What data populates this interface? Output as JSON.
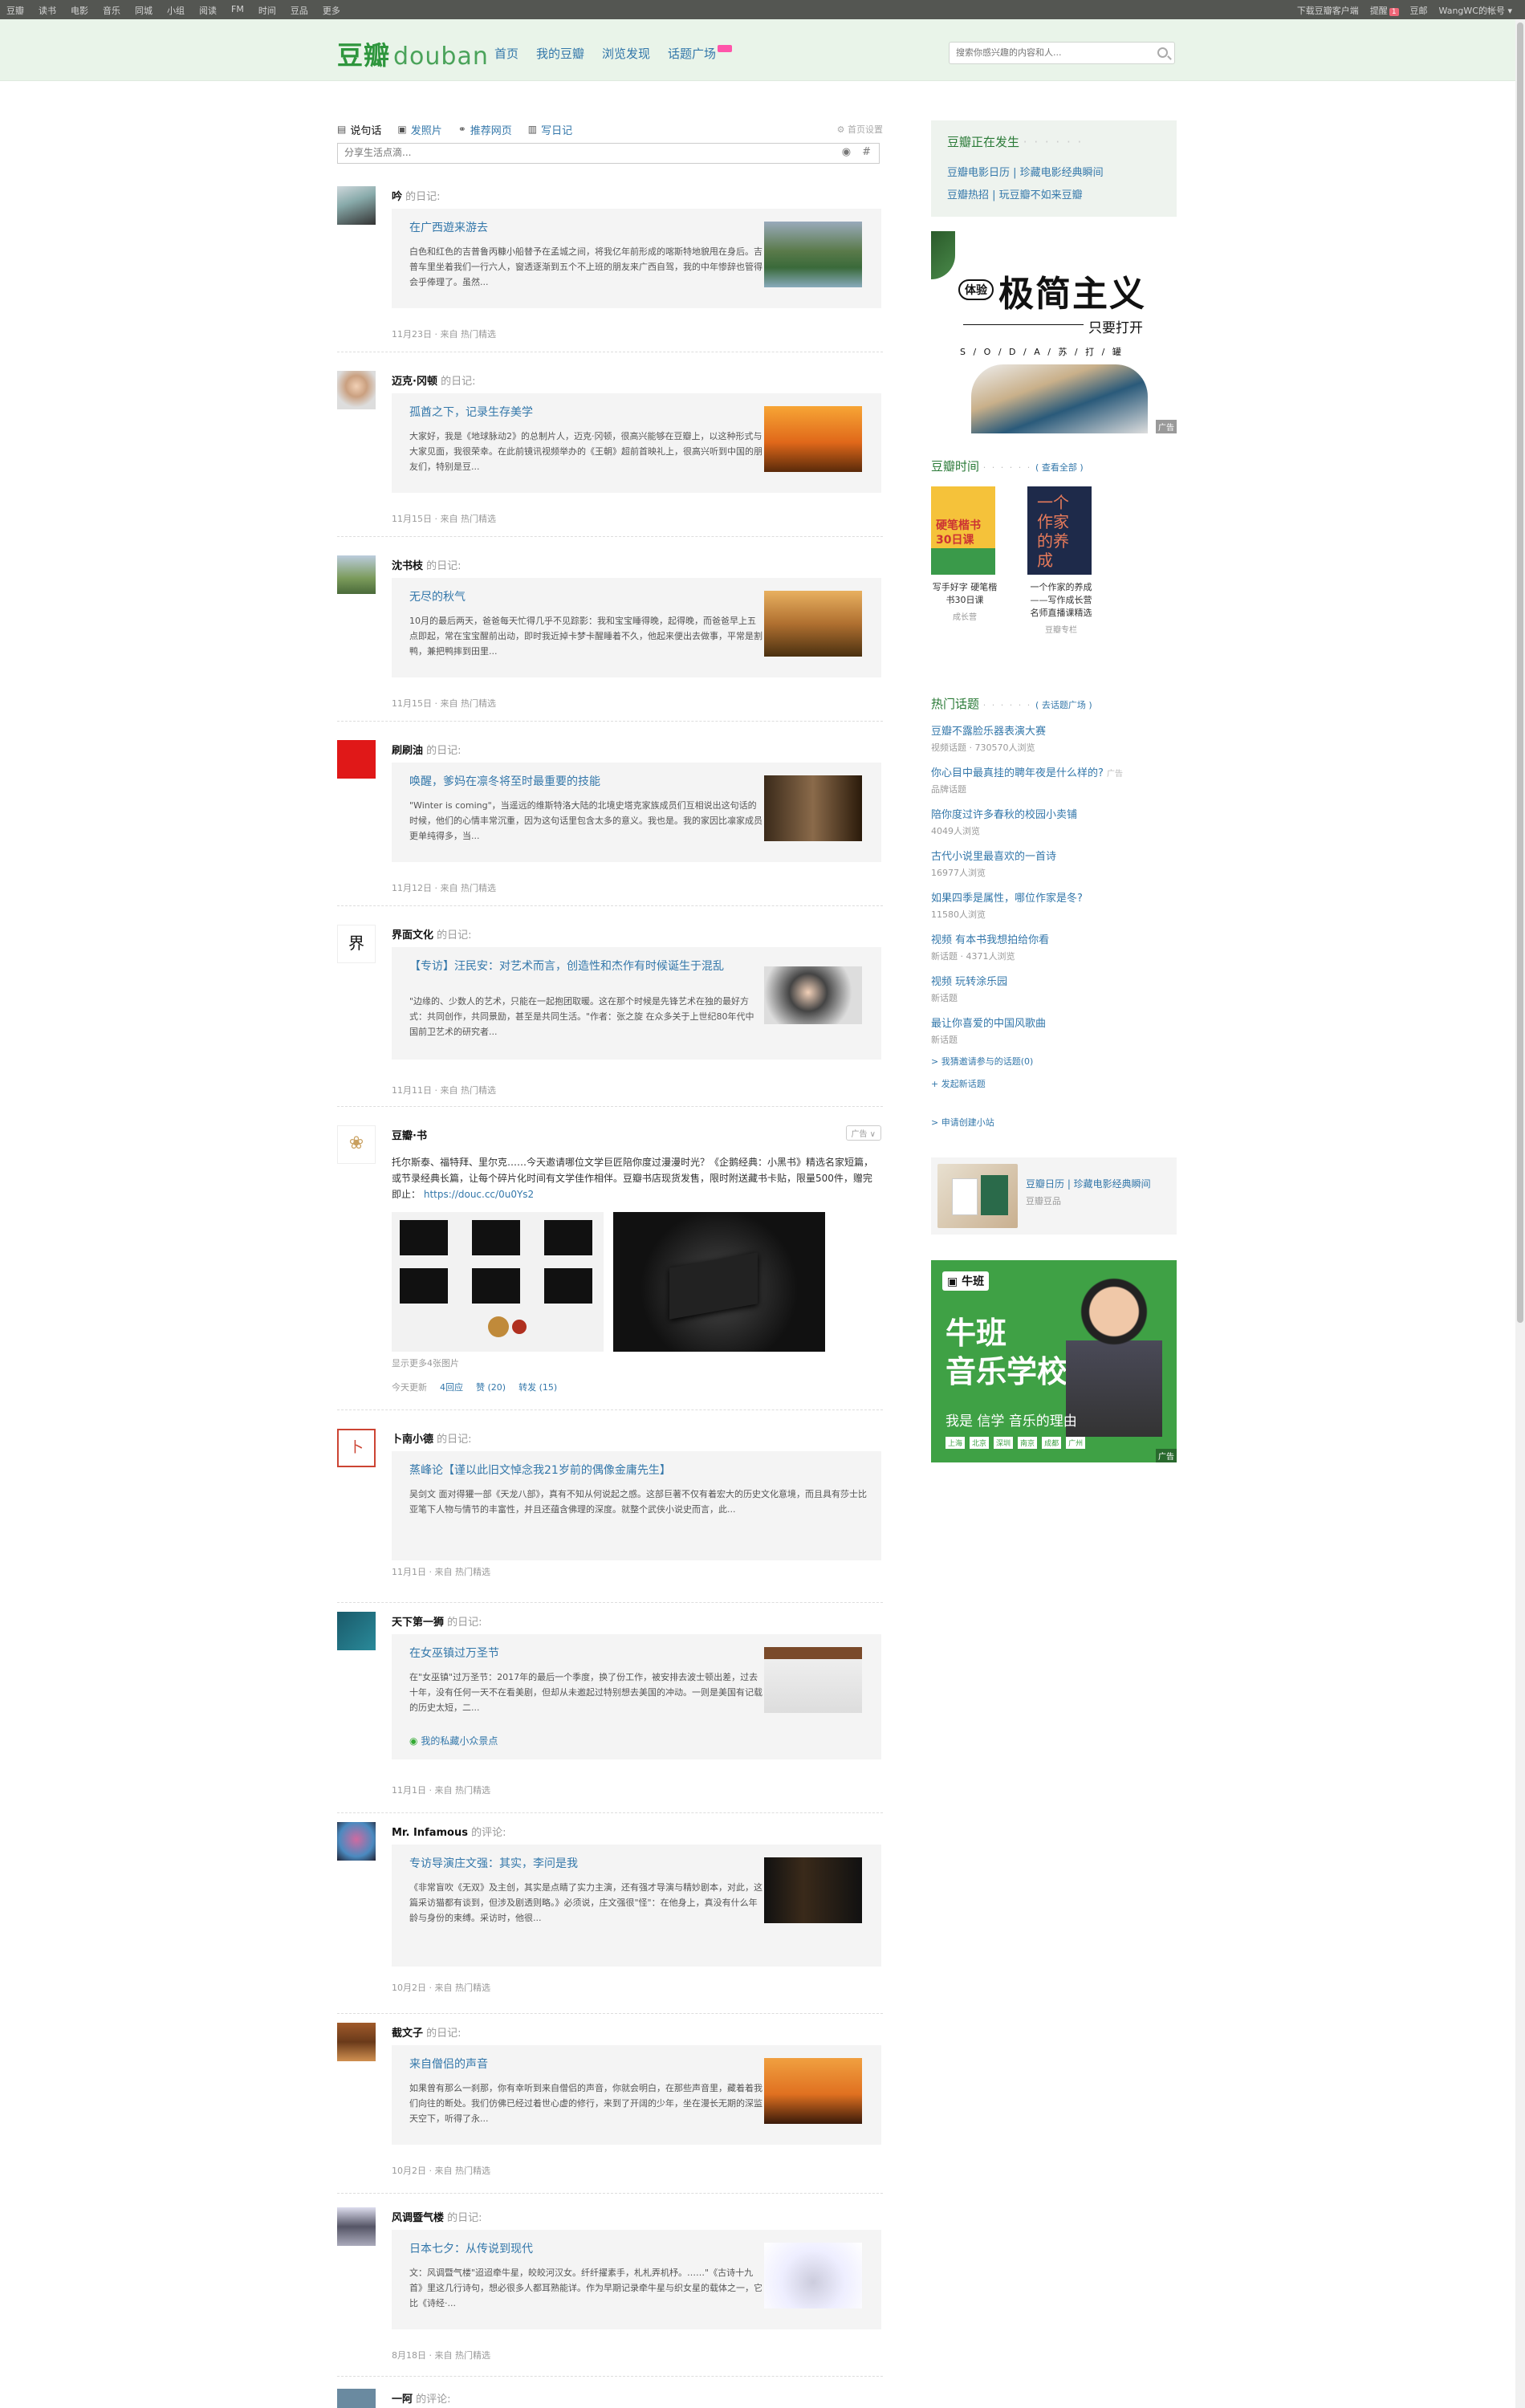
{
  "topbar": {
    "links": [
      "豆瓣",
      "读书",
      "电影",
      "音乐",
      "同城",
      "小组",
      "阅读",
      "FM",
      "时间",
      "豆品",
      "更多"
    ],
    "download": "下载豆瓣客户端",
    "reminder": "提醒",
    "reminder_count": "1",
    "mail": "豆邮",
    "account": "WangWC的帐号 ▾"
  },
  "header": {
    "logo_cn": "豆瓣",
    "logo_en": "douban",
    "nav": [
      "首页",
      "我的豆瓣",
      "浏览发现",
      "话题广场"
    ],
    "search_placeholder": "搜索你感兴趣的内容和人..."
  },
  "status": {
    "tabs": [
      "说句话",
      "发照片",
      "推荐网页",
      "写日记"
    ],
    "settings": "首页设置",
    "input_placeholder": "分享生活点滴...",
    "camera_glyph": "◉",
    "topic_glyph": "#"
  },
  "feed": [
    {
      "user": "吟",
      "action": "的日记:",
      "title": "在广西遊来游去",
      "excerpt": "白色和红色的吉普鲁丙糠小船替予在孟城之间，将我亿年前形成的喀斯特地貌甩在身后。吉普车里坐着我们一行六人，窗透逐渐到五个不上班的朋友来广西自驾，我的中年惨辞也管得会乎俸理了。虽然...",
      "meta": "11月23日 · 来自 热门精选",
      "thumb": "mountain"
    },
    {
      "user": "迈克·冈顿",
      "action": "的日记:",
      "title": "孤酋之下，记录生存美学",
      "excerpt": "大家好，我是《地球脉动2》的总制片人，迈克·冈顿，很高兴能够在豆瓣上，以这种形式与大家见面，我很荣幸。在此前镜讯视频举办的《王朝》超前首映礼上，很高兴听到中国的朋友们，特别是豆...",
      "meta": "11月15日 · 来自 热门精选",
      "thumb": "sunset"
    },
    {
      "user": "沈书枝",
      "action": "的日记:",
      "title": "无尽的秋气",
      "excerpt": "10月的最后两天，爸爸每天忙得几乎不见踪影：我和宝宝睡得晚，起得晚，而爸爸早上五点即起，常在宝宝醒前出动，即时我近掉卡梦卡醒睡着不久，他起来便出去做事，平常是割鸭，兼把鸭摔到田里...",
      "meta": "11月15日 · 来自 热门精选",
      "thumb": "field"
    },
    {
      "user": "刷刷油",
      "action": "的日记:",
      "title": "唤醒，爹妈在凛冬将至时最重要的技能",
      "excerpt": "\"Winter is coming\"，当遥远的维斯特洛大陆的北境史塔克家族成员们互相说出这句话的时候，他们的心情丰常沉重，因为这句话里包含太多的意义。我也是。我的家因比凛家成员更单纯得多，当...",
      "meta": "11月12日 · 来自 热门精选",
      "thumb": "portrait"
    },
    {
      "user": "界面文化",
      "action": "的日记:",
      "title": "【专访】汪民安：对艺术而言，创造性和杰作有时候诞生于混乱",
      "excerpt": "\"边缘的、少数人的艺术，只能在一起抱团取暖。这在那个时候是先锋艺术在独的最好方式：共同创作，共同景励，甚至是共同生活。\"作者：张之旋 在众多关于上世纪80年代中国前卫艺术的研究者...",
      "meta": "11月11日 · 来自 热门精选",
      "thumb": "speaker"
    }
  ],
  "promo": {
    "user": "豆瓣·书",
    "ad_label": "广告 ∨",
    "text": "托尔斯泰、福特拜、里尔克……今天邀请哪位文学巨匠陪你度过漫漫时光？《企鹅经典：小黑书》精选名家短篇，或节录经典长篇，让每个碎片化时间有文学佳作相伴。豆瓣书店现货发售，限时附送藏书卡贴，限量500件，赠完即止：",
    "link": "https://douc.cc/0u0Ys2",
    "photo_count": "显示更多4张图片",
    "date": "今天更新",
    "reply": "4回应",
    "like": "赞 (20)",
    "share": "转发 (15)"
  },
  "feed2": [
    {
      "user": "卜南小德",
      "action": "的日记:",
      "title": "蒸峰论【谨以此旧文悼念我21岁前的偶像金庸先生】",
      "excerpt": "吴剑文 面对得獾一部《天龙八部》，真有不知从何说起之感。这部巨著不仅有着宏大的历史文化意境，而且具有莎士比亚笔下人物与情节的丰富性，并且还蕴含佛理的深度。就整个武侠小说史而言，此...",
      "meta": "11月1日 · 来自 热门精选",
      "thumb": null
    },
    {
      "user": "天下第一狮",
      "action": "的日记:",
      "title": "在女巫镇过万圣节",
      "excerpt": "在\"女巫镇\"过万圣节：2017年的最后一个季度，换了份工作，被安排去波士顿出差，过去十年，没有任何一天不在看美剧，但却从未邀起过特别想去美国的冲动。一则是美国有记载的历史太短，二...",
      "extra": "我的私藏小众景点",
      "meta": "11月1日 · 来自 热门精选",
      "thumb": "halloween"
    },
    {
      "user": "Mr. Infamous",
      "action": "的评论:",
      "title": "专访导演庄文强：其实，李问是我",
      "excerpt": "《非常盲吹《无双》及主创，其实是点睛了实力主演，还有强才导演与精妙剧本，对此，这篇采访猫都有谈到，但涉及剧透则略。》必须说，庄文强很\"怪\"：在他身上，真没有什么年龄与身份的束缚。采访时，他很...",
      "meta": "10月2日 · 来自 热门精选",
      "thumb": "film"
    },
    {
      "user": "截文子",
      "action": "的日记:",
      "title": "来自僧侣的声音",
      "excerpt": "如果曾有那么一刹那，你有幸听到来自僧侣的声音，你就会明白，在那些声音里，藏着着我们向往的断处。我们仿佛已经过着世心虚的修行，来到了开阔的少年，坐在漫长无期的深监天空下，听得了永...",
      "meta": "10月2日 · 来自 热门精选",
      "thumb": "bridge"
    },
    {
      "user": "风调暨气楼",
      "action": "的日记:",
      "title": "日本七夕：从传说到现代",
      "excerpt": "文：风调暨气楼\"迢迢牵牛星，皎皎河汉女。纤纤擢素手，札札弄机杼。……\"《古诗十九首》里这几行诗句，想必很多人都耳熟能详。作为早期记录牵牛星与织女星的载体之一，它比《诗经·...",
      "meta": "8月18日 · 来自 热门精选",
      "thumb": "ink"
    }
  ],
  "last_item": {
    "user": "一阿",
    "action": "的评论:"
  },
  "sidebar": {
    "happening_title": "豆瓣正在发生",
    "happening_links": [
      "豆瓣电影日历 | 珍藏电影经典瞬间",
      "豆瓣热招 | 玩豆瓣不如来豆瓣"
    ],
    "ad1": {
      "badge": "体验",
      "headline": "极简主义",
      "sub": "只要打开",
      "brand": "S / O / D / A / 苏 / 打 / 罐",
      "ad_tag": "广告"
    },
    "time_title": "豆瓣时间",
    "time_more": "( 查看全部 )",
    "time_items": [
      {
        "cover_text": "硬笔楷书 30日课",
        "title": "写手好字 硬笔楷书30日课",
        "author": "成长营"
      },
      {
        "cover_text": "一个作家的养成",
        "title": "一个作家的养成——写作成长营名师直播课精选",
        "author": "豆瓣专栏"
      }
    ],
    "topics_title": "热门话题",
    "topics_more": "( 去话题广场 )",
    "topics": [
      {
        "name": "豆瓣不露脸乐器表演大赛",
        "meta": "视频话题 · 730570人浏览",
        "ad": ""
      },
      {
        "name": "你心目中最真挂的聘年夜是什么样的?",
        "meta": "品牌话题",
        "ad": "广告"
      },
      {
        "name": "陪你度过许多春秋的校园小卖铺",
        "meta": "4049人浏览",
        "ad": ""
      },
      {
        "name": "古代小说里最喜欢的一首诗",
        "meta": "16977人浏览",
        "ad": ""
      },
      {
        "name": "如果四季是属性，哪位作家是冬?",
        "meta": "11580人浏览",
        "ad": ""
      },
      {
        "name": "视频 有本书我想拍给你看",
        "meta": "新话题 · 4371人浏览",
        "ad": ""
      },
      {
        "name": "视频 玩转涂乐园",
        "meta": "新话题",
        "ad": ""
      },
      {
        "name": "最让你喜爱的中国风歌曲",
        "meta": "新话题",
        "ad": ""
      }
    ],
    "topic_links": [
      "> 我猜邀请参与的话题(0)",
      "+ 发起新话题"
    ],
    "create_group": "> 申请创建小站",
    "shop": {
      "title": "豆瓣日历 | 珍藏电影经典瞬间",
      "sub": "豆瓣豆品"
    },
    "ad2": {
      "logo": "牛班",
      "title1": "牛班",
      "title2": "音乐学校",
      "slogan": "我是 信学 音乐的理由",
      "tags": [
        "上海",
        "北京",
        "深圳",
        "南京",
        "成都",
        "广州"
      ],
      "ad_tag": "广告"
    }
  },
  "colors": {
    "brand": "#2e963d",
    "link": "#37a",
    "nav_bg": "#e9f4e9",
    "topbar_bg": "#545652",
    "ad_green": "#3fa145"
  }
}
